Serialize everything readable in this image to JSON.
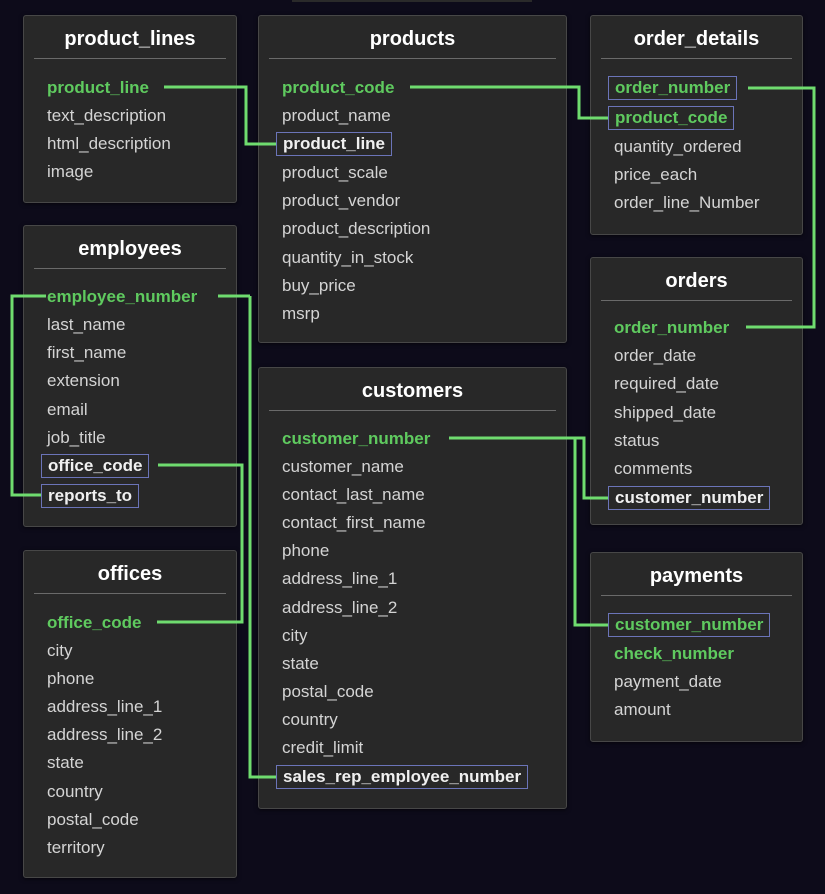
{
  "tables": {
    "product_lines": {
      "title": "product_lines",
      "fields": [
        "product_line",
        "text_description",
        "html_description",
        "image"
      ]
    },
    "products": {
      "title": "products",
      "fields": [
        "product_code",
        "product_name",
        "product_line",
        "product_scale",
        "product_vendor",
        "product_description",
        "quantity_in_stock",
        "buy_price",
        "msrp"
      ]
    },
    "order_details": {
      "title": "order_details",
      "fields": [
        "order_number",
        "product_code",
        "quantity_ordered",
        "price_each",
        "order_line_Number"
      ]
    },
    "employees": {
      "title": "employees",
      "fields": [
        "employee_number",
        "last_name",
        "first_name",
        "extension",
        "email",
        "job_title",
        "office_code",
        "reports_to"
      ]
    },
    "orders": {
      "title": "orders",
      "fields": [
        "order_number",
        "order_date",
        "required_date",
        "shipped_date",
        "status",
        "comments",
        "customer_number"
      ]
    },
    "customers": {
      "title": "customers",
      "fields": [
        "customer_number",
        "customer_name",
        "contact_last_name",
        "contact_first_name",
        "phone",
        "address_line_1",
        "address_line_2",
        "city",
        "state",
        "postal_code",
        "country",
        "credit_limit",
        "sales_rep_employee_number"
      ]
    },
    "offices": {
      "title": "offices",
      "fields": [
        "office_code",
        "city",
        "phone",
        "address_line_1",
        "address_line_2",
        "state",
        "country",
        "postal_code",
        "territory"
      ]
    },
    "payments": {
      "title": "payments",
      "fields": [
        "customer_number",
        "check_number",
        "payment_date",
        "amount"
      ]
    }
  },
  "colors": {
    "background": "#0d0b1a",
    "table_bg": "#282828",
    "primary_key": "#5fca5f",
    "foreign_key_border": "#6b74b8",
    "relation_line": "#6fdc6f"
  }
}
